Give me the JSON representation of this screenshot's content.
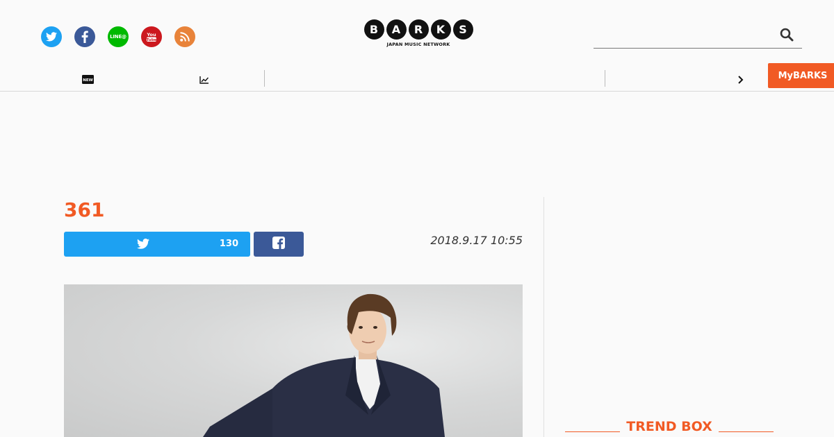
{
  "header": {
    "social": [
      {
        "name": "twitter",
        "color": "#1da1f2"
      },
      {
        "name": "facebook",
        "color": "#3b5998"
      },
      {
        "name": "line",
        "color": "#00b900",
        "label": "LINE@"
      },
      {
        "name": "youtube",
        "color": "#cc181e"
      },
      {
        "name": "rss",
        "color": "#e8833a"
      }
    ],
    "logo": {
      "letters": [
        "B",
        "A",
        "R",
        "K",
        "S"
      ],
      "tagline": "JAPAN MUSIC NETWORK"
    },
    "search": {
      "value": "",
      "placeholder": ""
    },
    "nav": {
      "new_badge": "NEW"
    },
    "mybarks_label": "MyBARKS"
  },
  "article": {
    "title": "361",
    "date": "2018.9.17 10:55",
    "twitter_count": "130"
  },
  "sidebar": {
    "trend_title": "TREND BOX"
  },
  "colors": {
    "accent": "#f15a24",
    "twitter": "#1da1f2",
    "facebook": "#3b5998"
  }
}
